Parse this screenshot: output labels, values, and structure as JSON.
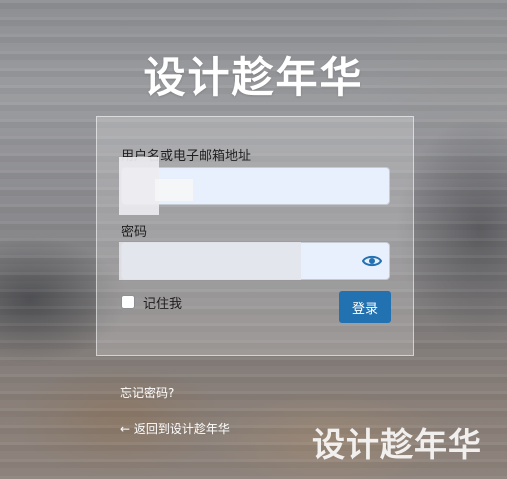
{
  "site": {
    "title": "设计趁年华"
  },
  "login_form": {
    "username_label": "用户名或电子邮箱地址",
    "username_value": "",
    "password_label": "密码",
    "password_value": "",
    "remember_label": "记住我",
    "remember_checked": false,
    "submit_label": "登录",
    "show_password_icon": "eye-icon"
  },
  "links": {
    "lost_password": "忘记密码?",
    "back_to_site": "← 返回到设计趁年华"
  },
  "watermark": {
    "text": "设计趁年华"
  },
  "colors": {
    "accent": "#2271b1",
    "input_background": "#e8f0fe"
  }
}
